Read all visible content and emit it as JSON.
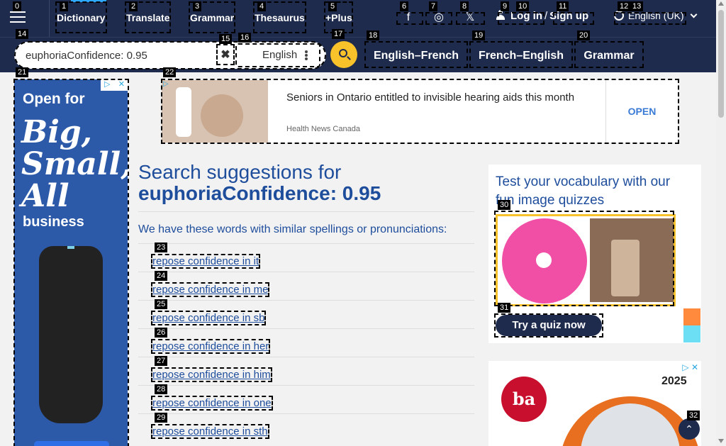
{
  "nav": {
    "links": [
      "Dictionary",
      "Translate",
      "Grammar",
      "Thesaurus",
      "+Plus"
    ],
    "social": [
      "facebook-icon",
      "instagram-icon",
      "x-icon"
    ],
    "login": "Log in",
    "signup": "Sign up",
    "language": "English (UK)"
  },
  "search": {
    "value": "euphoriaConfidence: 0.95",
    "dictionary": "English",
    "quick_links": [
      "English–French",
      "French–English",
      "Grammar"
    ]
  },
  "banner_ad": {
    "title": "Seniors in Ontario entitled to invisible hearing aids this month",
    "source": "Health News Canada",
    "cta": "OPEN"
  },
  "left_ad": {
    "line1": "Open for",
    "line2": "Big, Small, All",
    "line3": "business"
  },
  "main": {
    "heading": "Search suggestions for",
    "term": "euphoriaConfidence: 0.95",
    "intro": "We have these words with similar spellings or pronunciations:",
    "suggestions": [
      "repose confidence in it",
      "repose confidence in me",
      "repose confidence in sb",
      "repose confidence in her",
      "repose confidence in him",
      "repose confidence in one",
      "repose confidence in sth"
    ]
  },
  "quiz": {
    "title": "Test your vocabulary with our fun image quizzes",
    "button": "Try a quiz now"
  },
  "tent_ad": {
    "logo": "ba",
    "year": "2025"
  },
  "labels": [
    "0",
    "1",
    "2",
    "3",
    "4",
    "5",
    "6",
    "7",
    "8",
    "9",
    "10",
    "11",
    "12",
    "13",
    "14",
    "15",
    "16",
    "17",
    "18",
    "19",
    "20",
    "21",
    "22",
    "23",
    "24",
    "25",
    "26",
    "27",
    "28",
    "29",
    "30",
    "31",
    "32"
  ]
}
